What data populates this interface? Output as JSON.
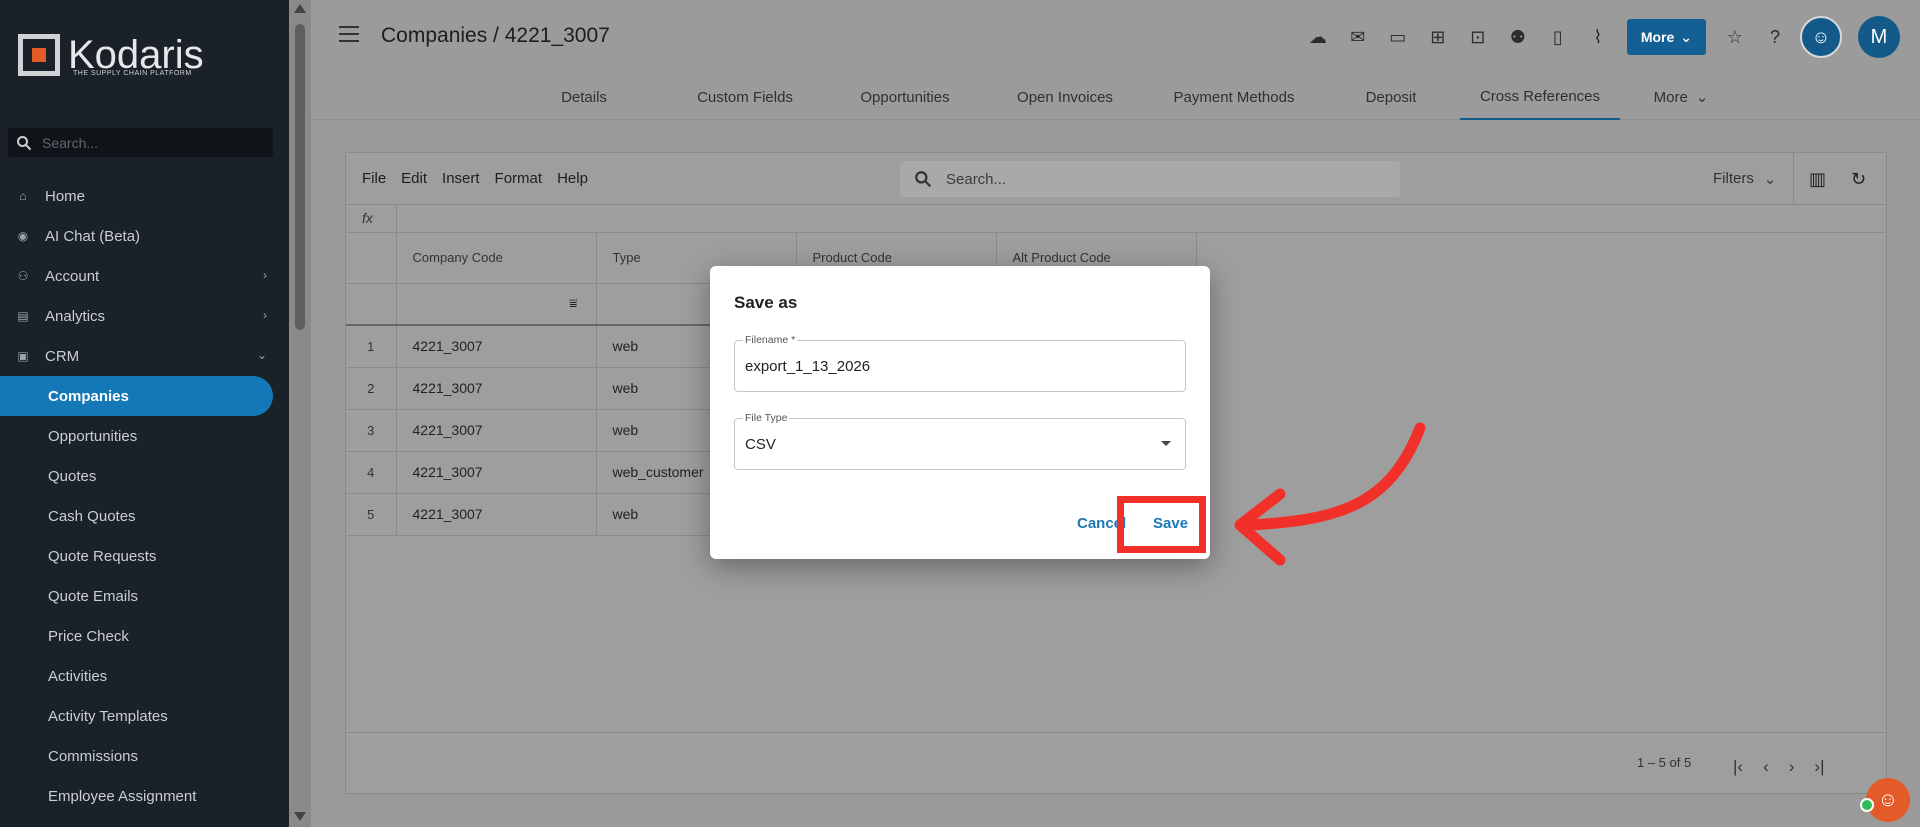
{
  "app": {
    "logo_text": "Kodaris",
    "logo_tagline": "THE SUPPLY CHAIN PLATFORM",
    "sidebar_search_placeholder": "Search..."
  },
  "sidebar": {
    "items": [
      {
        "label": "Home",
        "icon": "home-icon"
      },
      {
        "label": "AI Chat (Beta)",
        "icon": "robot-icon"
      },
      {
        "label": "Account",
        "icon": "person-icon",
        "chevron": "right"
      },
      {
        "label": "Analytics",
        "icon": "chart-icon",
        "chevron": "right"
      },
      {
        "label": "CRM",
        "icon": "crm-icon",
        "chevron": "down"
      }
    ],
    "crm_items": [
      {
        "label": "Companies",
        "active": true
      },
      {
        "label": "Opportunities"
      },
      {
        "label": "Quotes"
      },
      {
        "label": "Cash Quotes"
      },
      {
        "label": "Quote Requests"
      },
      {
        "label": "Quote Emails"
      },
      {
        "label": "Price Check"
      },
      {
        "label": "Activities"
      },
      {
        "label": "Activity Templates"
      },
      {
        "label": "Commissions"
      },
      {
        "label": "Employee Assignment"
      }
    ]
  },
  "header": {
    "title": "Companies / 4221_3007",
    "more_label": "More",
    "avatar_initial": "M"
  },
  "tabs": [
    {
      "label": "Details"
    },
    {
      "label": "Custom Fields"
    },
    {
      "label": "Opportunities"
    },
    {
      "label": "Open Invoices"
    },
    {
      "label": "Payment Methods"
    },
    {
      "label": "Deposit"
    },
    {
      "label": "Cross References",
      "active": true
    },
    {
      "label": "More"
    }
  ],
  "grid": {
    "menu": [
      "File",
      "Edit",
      "Insert",
      "Format",
      "Help"
    ],
    "search_placeholder": "Search...",
    "filters_label": "Filters",
    "fx_label": "fx",
    "columns": [
      "Company Code",
      "Type",
      "Product Code",
      "Alt Product Code"
    ],
    "rows": [
      {
        "num": "1",
        "company_code": "4221_3007",
        "type": "web"
      },
      {
        "num": "2",
        "company_code": "4221_3007",
        "type": "web"
      },
      {
        "num": "3",
        "company_code": "4221_3007",
        "type": "web"
      },
      {
        "num": "4",
        "company_code": "4221_3007",
        "type": "web_customer"
      },
      {
        "num": "5",
        "company_code": "4221_3007",
        "type": "web"
      }
    ],
    "pager_text": "1 – 5 of 5"
  },
  "dialog": {
    "title": "Save as",
    "filename_label": "Filename *",
    "filename_value": "export_1_13_2026",
    "filetype_label": "File Type",
    "filetype_value": "CSV",
    "cancel_label": "Cancel",
    "save_label": "Save"
  },
  "colors": {
    "sidebar_bg": "#1a2129",
    "accent": "#1578b6",
    "highlight": "#f2302a",
    "brand_orange": "#e35b28"
  }
}
